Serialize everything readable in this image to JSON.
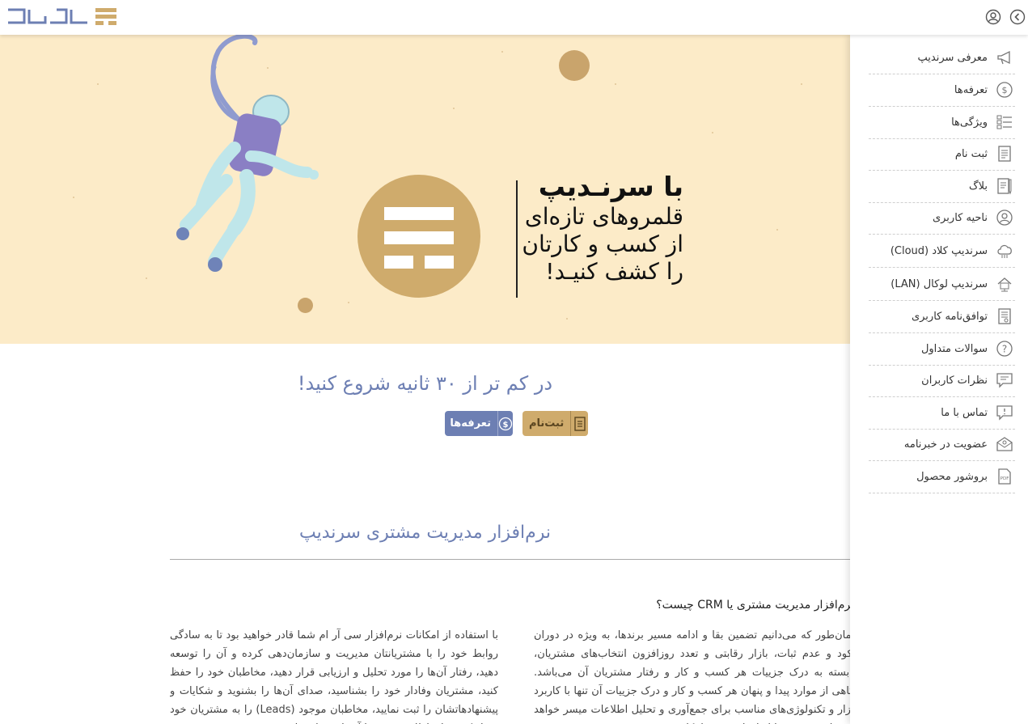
{
  "header": {
    "logo_alt": "سرندیپ"
  },
  "hero": {
    "title": "با سرنـدیپ",
    "lines": [
      "قلمروهای تازه‌ای",
      "از کسب و کارتان",
      "را کشف کنیـد!"
    ]
  },
  "start": {
    "title": "در کم تر از ۳۰ ثانیه شروع کنید!",
    "signup_label": "ثبت‌نام",
    "pricing_label": "تعرفه‌ها"
  },
  "crm": {
    "section_title": "نرم‌افزار مدیریت مشتری سرندیپ",
    "heading": "نرم‌افزار مدیریت مشتری یا CRM چیست؟",
    "right_col": "همان‌طور که می‌دانیم تضمین بقا و ادامه مسیر برندها، به ویژه در دوران رکود و عدم ثبات، بازار رقابتی و تعدد روزافزون انتخاب‌های مشتریان، وابسته به درک جزییات هر کسب و کار و رفتار مشتریان آن می‌باشد. آگاهی از موارد پیدا و پنهان هر کسب و کار و درک جزییات آن تنها با کاربرد ابزار و تکنولوژی‌های مناسب برای جمع‌آوری و تحلیل اطلاعات میسر خواهد بود و این موضوع با ابزارهای سنتی امکان‌پذیر نیست.",
    "left_col": "با استفاده از امکانات نرم‌افزار سی آر ام شما قادر خواهید بود تا به سادگی روابط خود را با مشتریانتان مدیریت و سازمان‌دهی کرده و آن را توسعه دهید، رفتار آن‌ها را مورد تحلیل و ارزیابی قرار دهید، مخاطبان خود را حفظ کنید، مشتریان وفادار خود را بشناسید، صدای آن‌ها را بشنوید و شکایات و پیشنهادهاتشان را ثبت نمایید، مخاطبان موجود (Leads) را به مشتریان خود تبدیل کنید و ارتباطات مؤثری با آن‌ها برقرار نمایید."
  },
  "sidemenu": {
    "items": [
      {
        "label": "معرفی سرندیپ",
        "icon": "megaphone-icon"
      },
      {
        "label": "تعرفه‌ها",
        "icon": "dollar-icon"
      },
      {
        "label": "ویژگی‌ها",
        "icon": "features-list-icon"
      },
      {
        "label": "ثبت نام",
        "icon": "document-icon"
      },
      {
        "label": "بلاگ",
        "icon": "blog-icon"
      },
      {
        "label": "ناحیه کاربری",
        "icon": "user-icon"
      },
      {
        "label": "سرندیپ کلاد (Cloud)",
        "icon": "cloud-icon"
      },
      {
        "label": "سرندیپ لوکال (LAN)",
        "icon": "local-network-icon"
      },
      {
        "label": "توافق‌نامه کاربری",
        "icon": "agreement-icon"
      },
      {
        "label": "سوالات متداول",
        "icon": "question-icon"
      },
      {
        "label": "نظرات کاربران",
        "icon": "comments-icon"
      },
      {
        "label": "تماس با ما",
        "icon": "contact-icon"
      },
      {
        "label": "عضویت در خبرنامه",
        "icon": "newsletter-icon"
      },
      {
        "label": "بروشور محصول",
        "icon": "pdf-icon"
      }
    ]
  },
  "colors": {
    "brand_blue": "#6d7fb3",
    "brand_gold": "#cfab6c",
    "hero_bg": "#fcebc8"
  }
}
